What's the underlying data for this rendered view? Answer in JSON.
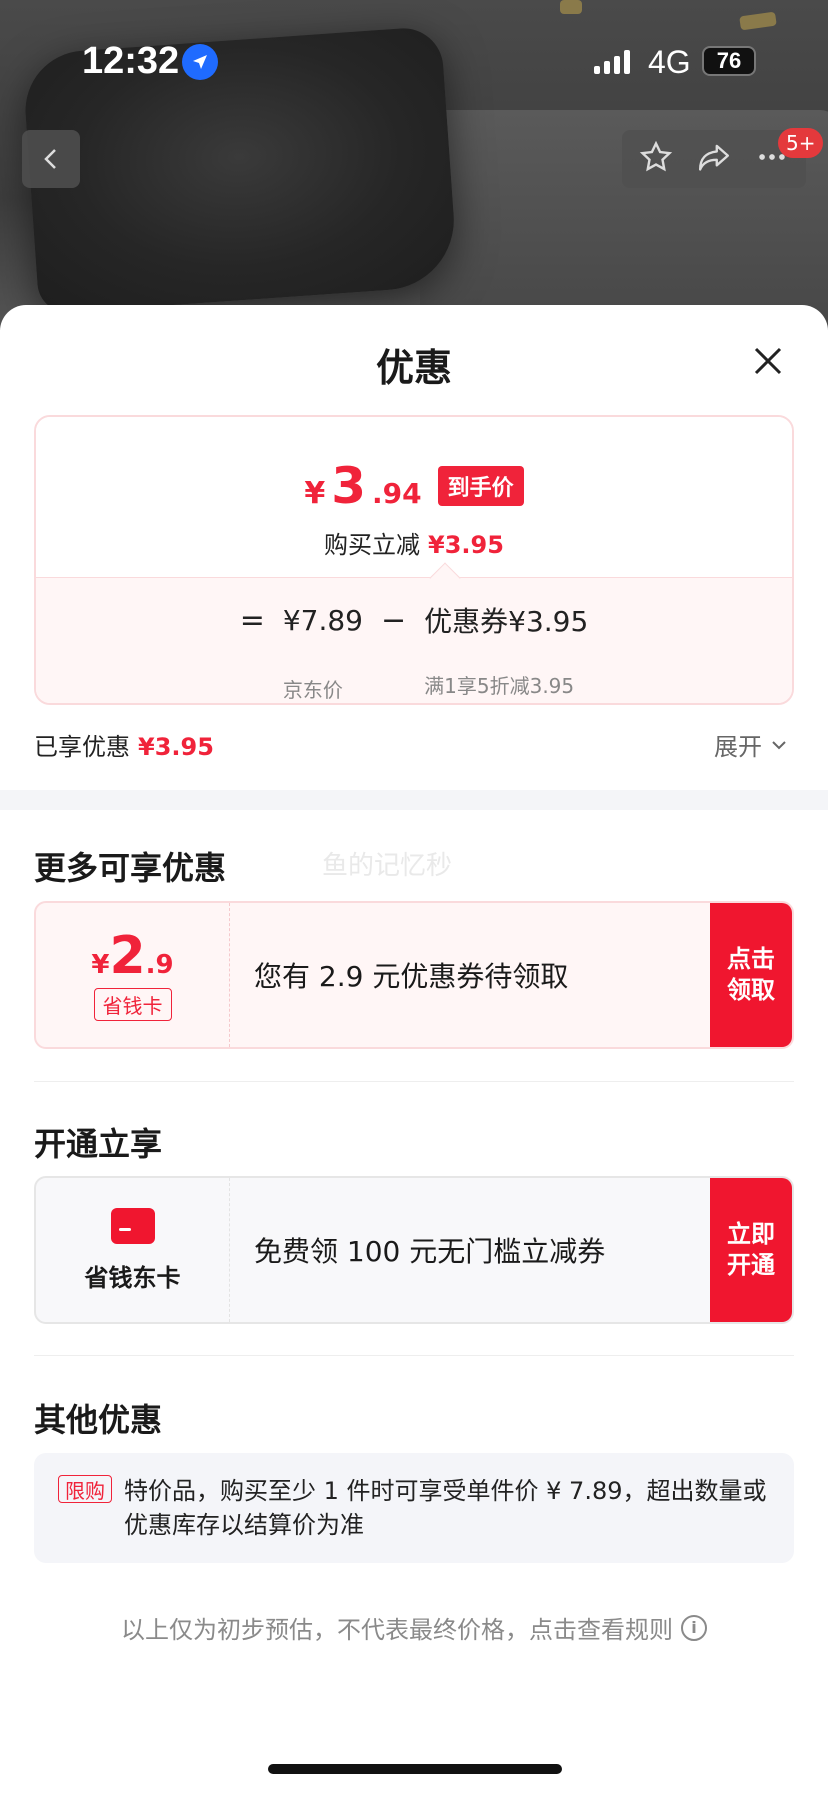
{
  "status_bar": {
    "time": "12:32",
    "network": "4G",
    "battery": "76"
  },
  "nav": {
    "badge": "5+"
  },
  "sheet": {
    "title": "优惠",
    "price_card": {
      "final_yen": "¥",
      "final_int": "3",
      "final_dec": ".94",
      "final_tag": "到手价",
      "instant_label": "购买立减",
      "instant_amount": "¥3.95",
      "eq": "=",
      "jd_price": "¥7.89",
      "jd_price_label": "京东价",
      "minus": "−",
      "coupon": "优惠券¥3.95",
      "coupon_label": "满1享5折减3.95"
    },
    "enjoyed_label": "已享优惠",
    "enjoyed_amount": "¥3.95",
    "expand_label": "展开",
    "more_title": "更多可享优惠",
    "watermark": "鱼的记忆秒",
    "more_offer": {
      "yen": "¥",
      "int": "2",
      "dec": ".9",
      "tag": "省钱卡",
      "text": "您有 2.9 元优惠券待领取",
      "button": "点击领取"
    },
    "open_title": "开通立享",
    "open_offer": {
      "card_name": "省钱东卡",
      "text": "免费领 100 元无门槛立减券",
      "button": "立即开通"
    },
    "other_title": "其他优惠",
    "other_offer": {
      "tag": "限购",
      "text": "特价品，购买至少 1 件时可享受单件价 ¥ 7.89，超出数量或优惠库存以结算价为准"
    },
    "footer_note": "以上仅为初步预估，不代表最终价格，点击查看规则"
  },
  "colors": {
    "accent_red": "#f0233a",
    "button_red": "#f0162f",
    "location_blue": "#1f6bff"
  }
}
